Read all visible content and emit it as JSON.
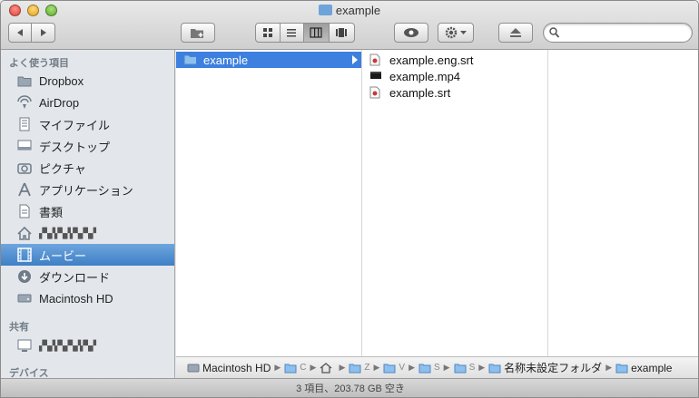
{
  "window": {
    "title": "example"
  },
  "toolbar": {
    "search_value": "",
    "search_placeholder": ""
  },
  "sidebar": {
    "favorites_header": "よく使う項目",
    "shared_header": "共有",
    "devices_header": "デバイス",
    "items": [
      {
        "label": "Dropbox",
        "icon": "folder-icon"
      },
      {
        "label": "AirDrop",
        "icon": "airdrop-icon"
      },
      {
        "label": "マイファイル",
        "icon": "all-files-icon"
      },
      {
        "label": "デスクトップ",
        "icon": "desktop-icon"
      },
      {
        "label": "ピクチャ",
        "icon": "camera-icon"
      },
      {
        "label": "アプリケーション",
        "icon": "applications-icon"
      },
      {
        "label": "書類",
        "icon": "documents-icon"
      },
      {
        "label": "▞▚▞▞▚▞▞▚▞▚▞",
        "icon": "home-icon"
      },
      {
        "label": "ムービー",
        "icon": "film-icon"
      },
      {
        "label": "ダウンロード",
        "icon": "download-icon"
      },
      {
        "label": "Macintosh HD",
        "icon": "hard-drive-icon"
      }
    ],
    "shared_items": [
      {
        "label": "▞▚▞▞▚▞▚▞▞▚▞",
        "icon": "computer-icon"
      }
    ]
  },
  "columns": {
    "col1": [
      {
        "name": "example",
        "selected": true
      }
    ],
    "col2": [
      {
        "name": "example.eng.srt",
        "kind": "srt"
      },
      {
        "name": "example.mp4",
        "kind": "video"
      },
      {
        "name": "example.srt",
        "kind": "srt"
      }
    ]
  },
  "pathbar": {
    "items": [
      {
        "label": "Macintosh HD"
      },
      {
        "label": "C"
      },
      {
        "label": ""
      },
      {
        "label": "Z"
      },
      {
        "label": "V"
      },
      {
        "label": "S"
      },
      {
        "label": "S"
      },
      {
        "label": "名称未設定フォルダ"
      },
      {
        "label": "example"
      }
    ]
  },
  "status": {
    "text": "3 項目、203.78 GB 空き"
  },
  "colors": {
    "selection": "#3d80df",
    "sidebar_bg": "#e3e7ec",
    "folder": "#6ea4d9"
  }
}
